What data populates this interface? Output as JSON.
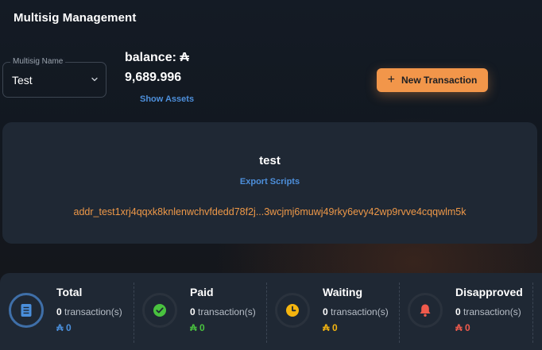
{
  "header": {
    "title": "Multisig Management"
  },
  "multisig_select": {
    "label": "Multisig Name",
    "value": "Test"
  },
  "balance": {
    "label": "balance: ₳",
    "value": "9,689.996",
    "show_assets": "Show Assets"
  },
  "actions": {
    "new_transaction": "New Transaction"
  },
  "wallet": {
    "name": "test",
    "export_scripts": "Export Scripts",
    "address": "addr_test1xrj4qqxk8knlenwchvfdedd78f2j...3wcjmj6muwj49rky6evy42wp9rvve4cqqwlm5k"
  },
  "stats": [
    {
      "title": "Total",
      "count": "0",
      "unit": "transaction(s)",
      "amount": "₳ 0",
      "color": "#4a8fdc",
      "icon": "receipt-icon"
    },
    {
      "title": "Paid",
      "count": "0",
      "unit": "transaction(s)",
      "amount": "₳ 0",
      "color": "#49c23f",
      "icon": "check-circle-icon"
    },
    {
      "title": "Waiting",
      "count": "0",
      "unit": "transaction(s)",
      "amount": "₳ 0",
      "color": "#f5b50f",
      "icon": "clock-icon"
    },
    {
      "title": "Disapproved",
      "count": "0",
      "unit": "transaction(s)",
      "amount": "₳ 0",
      "color": "#ef5a4c",
      "icon": "bell-icon"
    }
  ]
}
